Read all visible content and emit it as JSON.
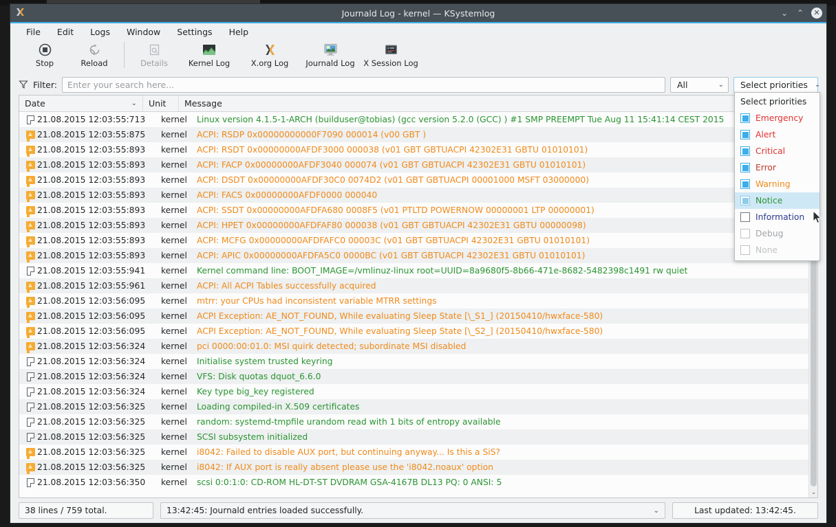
{
  "window": {
    "title": "Journald Log - kernel — KSystemlog",
    "logo_icon": "ksystemlog-icon",
    "buttons": {
      "minimize": "⌄",
      "maximize": "⌃",
      "close": "✕"
    }
  },
  "menubar": [
    {
      "label": "File"
    },
    {
      "label": "Edit"
    },
    {
      "label": "Logs"
    },
    {
      "label": "Window"
    },
    {
      "label": "Settings"
    },
    {
      "label": "Help"
    }
  ],
  "toolbar": [
    {
      "label": "Stop",
      "icon": "stop-icon",
      "disabled": false
    },
    {
      "label": "Reload",
      "icon": "reload-icon",
      "disabled": false
    },
    {
      "label": "Details",
      "icon": "details-icon",
      "disabled": true
    },
    {
      "label": "Kernel Log",
      "icon": "kernel-log-icon",
      "disabled": false
    },
    {
      "label": "X.org Log",
      "icon": "xorg-log-icon",
      "disabled": false
    },
    {
      "label": "Journald Log",
      "icon": "journald-log-icon",
      "disabled": false
    },
    {
      "label": "X Session Log",
      "icon": "x-session-log-icon",
      "disabled": false
    }
  ],
  "filterbar": {
    "icon": "filter-icon",
    "label": "Filter:",
    "search_value": "",
    "search_placeholder": "Enter your search here...",
    "column_filter": "All",
    "priorities_button": "Select priorities"
  },
  "priorities_popup": {
    "title": "Select priorities",
    "items": [
      {
        "label": "Emergency",
        "checked": true,
        "enabled": true,
        "color": "#e0322f",
        "highlighted": false
      },
      {
        "label": "Alert",
        "checked": true,
        "enabled": true,
        "color": "#e0322f",
        "highlighted": false
      },
      {
        "label": "Critical",
        "checked": true,
        "enabled": true,
        "color": "#e0322f",
        "highlighted": false
      },
      {
        "label": "Error",
        "checked": true,
        "enabled": true,
        "color": "#c0392b",
        "highlighted": false
      },
      {
        "label": "Warning",
        "checked": true,
        "enabled": true,
        "color": "#f08a1b",
        "highlighted": false
      },
      {
        "label": "Notice",
        "checked": true,
        "enabled": true,
        "color": "#2a9432",
        "highlighted": true
      },
      {
        "label": "Information",
        "checked": false,
        "enabled": true,
        "color": "#2b3a8f",
        "highlighted": false
      },
      {
        "label": "Debug",
        "checked": false,
        "enabled": false,
        "color": "#a0a4a8",
        "highlighted": false
      },
      {
        "label": "None",
        "checked": false,
        "enabled": false,
        "color": "#bfc3c6",
        "highlighted": false
      }
    ]
  },
  "table": {
    "columns": [
      {
        "key": "date",
        "label": "Date",
        "sort": "⌄"
      },
      {
        "key": "unit",
        "label": "Unit"
      },
      {
        "key": "message",
        "label": "Message"
      }
    ],
    "rows": [
      {
        "icon": "document-icon",
        "date": "21.08.2015 12:03:55:713",
        "unit": "kernel",
        "level": "notice",
        "message": "Linux version 4.1.5-1-ARCH (builduser@tobias) (gcc version 5.2.0 (GCC) ) #1 SMP PREEMPT Tue Aug 11 15:41:14 CEST 2015"
      },
      {
        "icon": "warning-bubble-icon",
        "date": "21.08.2015 12:03:55:875",
        "unit": "kernel",
        "level": "warning",
        "message": "ACPI: RSDP 0x00000000000F7090 000014 (v00 GBT   )"
      },
      {
        "icon": "warning-bubble-icon",
        "date": "21.08.2015 12:03:55:893",
        "unit": "kernel",
        "level": "warning",
        "message": "ACPI: RSDT 0x00000000AFDF3000 000038 (v01 GBT    GBTUACPI 42302E31 GBTU 01010101)"
      },
      {
        "icon": "warning-bubble-icon",
        "date": "21.08.2015 12:03:55:893",
        "unit": "kernel",
        "level": "warning",
        "message": "ACPI: FACP 0x00000000AFDF3040 000074 (v01 GBT    GBTUACPI 42302E31 GBTU 01010101)"
      },
      {
        "icon": "warning-bubble-icon",
        "date": "21.08.2015 12:03:55:893",
        "unit": "kernel",
        "level": "warning",
        "message": "ACPI: DSDT 0x00000000AFDF30C0 0074D2 (v01 GBT    GBTUACPI 00001000 MSFT 03000000)"
      },
      {
        "icon": "warning-bubble-icon",
        "date": "21.08.2015 12:03:55:893",
        "unit": "kernel",
        "level": "warning",
        "message": "ACPI: FACS 0x00000000AFDF0000 000040"
      },
      {
        "icon": "warning-bubble-icon",
        "date": "21.08.2015 12:03:55:893",
        "unit": "kernel",
        "level": "warning",
        "message": "ACPI: SSDT 0x00000000AFDFA680 0008F5 (v01 PTLTD  POWERNOW 00000001  LTP 00000001)"
      },
      {
        "icon": "warning-bubble-icon",
        "date": "21.08.2015 12:03:55:893",
        "unit": "kernel",
        "level": "warning",
        "message": "ACPI: HPET 0x00000000AFDFAF80 000038 (v01 GBT    GBTUACPI 42302E31 GBTU 00000098)"
      },
      {
        "icon": "warning-bubble-icon",
        "date": "21.08.2015 12:03:55:893",
        "unit": "kernel",
        "level": "warning",
        "message": "ACPI: MCFG 0x00000000AFDFAFC0 00003C (v01 GBT    GBTUACPI 42302E31 GBTU 01010101)"
      },
      {
        "icon": "warning-bubble-icon",
        "date": "21.08.2015 12:03:55:893",
        "unit": "kernel",
        "level": "warning",
        "message": "ACPI: APIC 0x00000000AFDFA5C0 0000BC (v01 GBT    GBTUACPI 42302E31 GBTU 01010101)"
      },
      {
        "icon": "document-icon",
        "date": "21.08.2015 12:03:55:941",
        "unit": "kernel",
        "level": "notice",
        "message": "Kernel command line: BOOT_IMAGE=/vmlinuz-linux root=UUID=8a9680f5-8b66-471e-8682-5482398c1491 rw quiet"
      },
      {
        "icon": "warning-bubble-icon",
        "date": "21.08.2015 12:03:55:961",
        "unit": "kernel",
        "level": "warning",
        "message": "ACPI: All ACPI Tables successfully acquired"
      },
      {
        "icon": "warning-bubble-icon",
        "date": "21.08.2015 12:03:56:095",
        "unit": "kernel",
        "level": "warning",
        "message": "mtrr: your CPUs had inconsistent variable MTRR settings"
      },
      {
        "icon": "warning-bubble-icon",
        "date": "21.08.2015 12:03:56:095",
        "unit": "kernel",
        "level": "warning",
        "message": "ACPI Exception: AE_NOT_FOUND, While evaluating Sleep State [\\_S1_] (20150410/hwxface-580)"
      },
      {
        "icon": "warning-bubble-icon",
        "date": "21.08.2015 12:03:56:095",
        "unit": "kernel",
        "level": "warning",
        "message": "ACPI Exception: AE_NOT_FOUND, While evaluating Sleep State [\\_S2_] (20150410/hwxface-580)"
      },
      {
        "icon": "warning-bubble-icon",
        "date": "21.08.2015 12:03:56:324",
        "unit": "kernel",
        "level": "warning",
        "message": "pci 0000:00:01.0: MSI quirk detected; subordinate MSI disabled"
      },
      {
        "icon": "document-icon",
        "date": "21.08.2015 12:03:56:324",
        "unit": "kernel",
        "level": "notice",
        "message": "Initialise system trusted keyring"
      },
      {
        "icon": "document-icon",
        "date": "21.08.2015 12:03:56:324",
        "unit": "kernel",
        "level": "notice",
        "message": "VFS: Disk quotas dquot_6.6.0"
      },
      {
        "icon": "document-icon",
        "date": "21.08.2015 12:03:56:324",
        "unit": "kernel",
        "level": "notice",
        "message": "Key type big_key registered"
      },
      {
        "icon": "document-icon",
        "date": "21.08.2015 12:03:56:325",
        "unit": "kernel",
        "level": "notice",
        "message": "Loading compiled-in X.509 certificates"
      },
      {
        "icon": "document-icon",
        "date": "21.08.2015 12:03:56:325",
        "unit": "kernel",
        "level": "notice",
        "message": "random: systemd-tmpfile urandom read with 1 bits of entropy available"
      },
      {
        "icon": "document-icon",
        "date": "21.08.2015 12:03:56:325",
        "unit": "kernel",
        "level": "notice",
        "message": "SCSI subsystem initialized"
      },
      {
        "icon": "warning-bubble-icon",
        "date": "21.08.2015 12:03:56:325",
        "unit": "kernel",
        "level": "warning",
        "message": "i8042: Failed to disable AUX port, but continuing anyway... Is this a SiS?"
      },
      {
        "icon": "warning-bubble-icon",
        "date": "21.08.2015 12:03:56:325",
        "unit": "kernel",
        "level": "warning",
        "message": "i8042: If AUX port is really absent please use the 'i8042.noaux' option"
      },
      {
        "icon": "document-icon",
        "date": "21.08.2015 12:03:56:350",
        "unit": "kernel",
        "level": "notice",
        "message": "scsi 0:0:1:0: CD-ROM            HL-DT-ST DVDRAM GSA-4167B DL13 PQ: 0 ANSI: 5"
      }
    ]
  },
  "statusbar": {
    "lines": "38 lines / 759 total.",
    "message": "13:42:45: Journald entries loaded successfully.",
    "last_updated": "Last updated: 13:42:45."
  },
  "colors": {
    "accent": "#3daee9",
    "titlebar": "#475057",
    "notice": "#2a9432",
    "warning": "#f08a1b",
    "error": "#e0322f"
  }
}
